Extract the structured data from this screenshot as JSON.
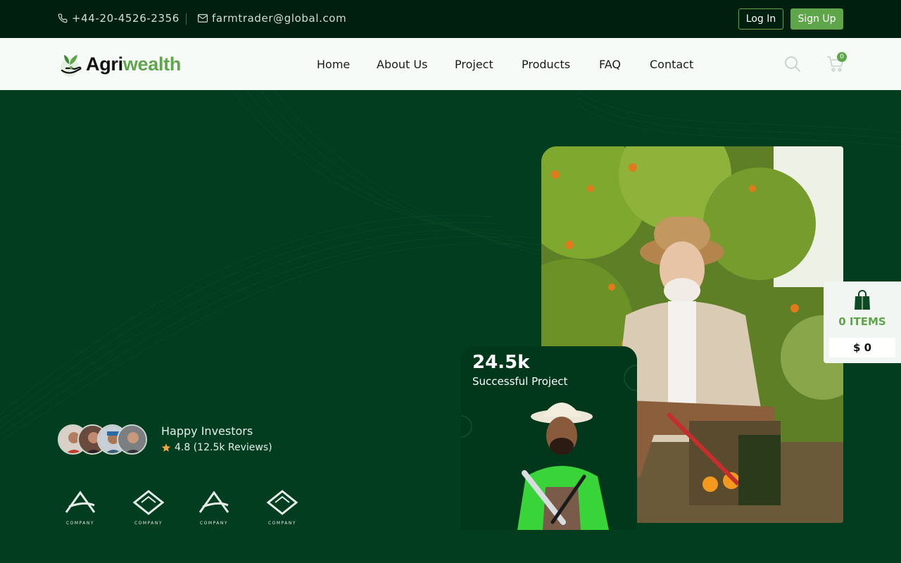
{
  "topbar": {
    "phone": "+44-20-4526-2356",
    "email": "farmtrader@global.com",
    "login_label": "Log In",
    "signup_label": "Sign Up"
  },
  "brand": {
    "part1": "Agri",
    "part2": "wealth",
    "accent_color": "#5fa64a"
  },
  "nav": {
    "items": [
      "Home",
      "About Us",
      "Project",
      "Products",
      "FAQ",
      "Contact"
    ],
    "cart_count": "0"
  },
  "hero": {
    "stat_value": "24.5k",
    "stat_label": "Successful Project",
    "investors_title": "Happy Investors",
    "rating": "4.8 (12.5k Reviews)",
    "company_logos": [
      "COMPANY",
      "COMPANY",
      "COMPANY",
      "COMPANY"
    ]
  },
  "side_cart": {
    "items_label": "0 ITEMS",
    "price_label": "$ 0"
  },
  "icons": [
    "phone-icon",
    "mail-icon",
    "search-icon",
    "cart-icon",
    "star-icon",
    "shopping-bag-icon"
  ],
  "colors": {
    "topbar_bg": "#011f0f",
    "hero_bg": "#013d1e",
    "accent": "#5fa64a",
    "star": "#f0a640"
  }
}
